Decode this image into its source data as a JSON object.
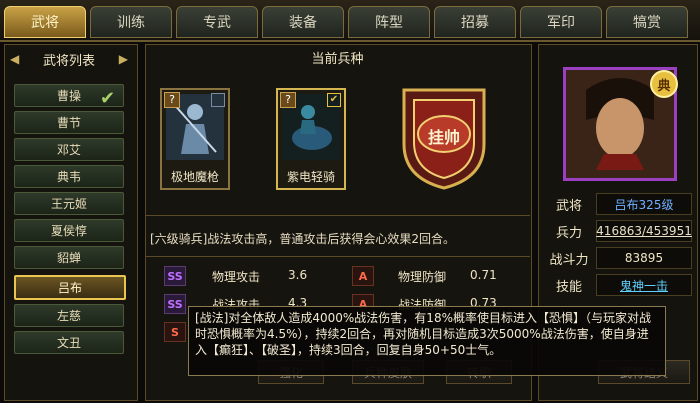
{
  "tabs": [
    "武将",
    "训练",
    "专武",
    "装备",
    "阵型",
    "招募",
    "军印",
    "犒赏"
  ],
  "left": {
    "title": "武将列表",
    "generals": [
      "曹操",
      "曹节",
      "邓艾",
      "典韦",
      "王元姬",
      "夏侯惇",
      "貂蝉",
      "吕布",
      "左慈",
      "文丑"
    ],
    "selected_index": 7,
    "checked_index": 0
  },
  "center": {
    "title": "当前兵种",
    "units": [
      {
        "name": "极地魔枪",
        "selected": false
      },
      {
        "name": "紫电轻骑",
        "selected": true
      }
    ],
    "emblem_text": "挂帅",
    "description": "[六级骑兵]战法攻击高，普通攻击后获得会心效果2回合。",
    "stats": [
      {
        "grade": "SS",
        "label": "物理攻击",
        "value": "3.6"
      },
      {
        "grade": "A",
        "label": "物理防御",
        "value": "0.71"
      },
      {
        "grade": "SS",
        "label": "战法攻击",
        "value": "4.3"
      },
      {
        "grade": "A",
        "label": "战法防御",
        "value": "0.73"
      },
      {
        "grade": "S",
        "label": "",
        "value": ""
      }
    ],
    "buttons": [
      "强化",
      "兵种皮肤",
      "转职"
    ]
  },
  "right": {
    "badge": "典",
    "rows": [
      {
        "label": "武将",
        "value": "吕布325级"
      },
      {
        "label": "兵力",
        "value": "416863/453951"
      },
      {
        "label": "战斗力",
        "value": "83895"
      },
      {
        "label": "技能",
        "value": "鬼神一击"
      }
    ],
    "bottom_button": "武将结义"
  },
  "tooltip": "[战法]对全体敌人造成4000%战法伤害，有18%概率使目标进入【恐惧】（与玩家对战时恐惧概率为4.5%），持续2回合，再对随机目标造成3次5000%战法伤害，使自身进入【癫狂】、【破圣】，持续3回合，回复自身50+50士气。",
  "colors": {
    "accent": "#d6b650",
    "purple_frame": "#9a40c0",
    "grade_ss": "#c070ff",
    "grade_a": "#ff6a4a"
  }
}
